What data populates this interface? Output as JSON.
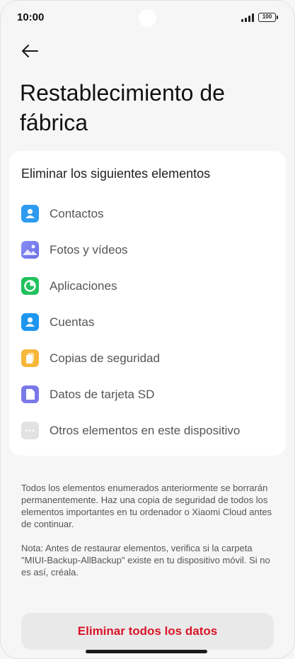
{
  "status_bar": {
    "time": "10:00",
    "battery": "100"
  },
  "header": {
    "back_icon": "arrow-left-icon",
    "title": "Restablecimiento de fábrica"
  },
  "card": {
    "heading": "Eliminar los siguientes elementos",
    "items": [
      {
        "label": "Contactos",
        "icon": "contacts-icon",
        "color": "#2d9bf0"
      },
      {
        "label": "Fotos y vídeos",
        "icon": "gallery-icon",
        "color": "#7c83f2"
      },
      {
        "label": "Aplicaciones",
        "icon": "apps-icon",
        "color": "#21c25e"
      },
      {
        "label": "Cuentas",
        "icon": "accounts-icon",
        "color": "#1e96f0"
      },
      {
        "label": "Copias de seguridad",
        "icon": "backup-icon",
        "color": "#f7b73a"
      },
      {
        "label": "Datos de tarjeta SD",
        "icon": "sd-card-icon",
        "color": "#7b79e8"
      },
      {
        "label": "Otros elementos en este dispositivo",
        "icon": "more-icon",
        "color": "#e2e2e2"
      }
    ]
  },
  "description": "Todos los elementos enumerados anteriormente se borrarán permanentemente. Haz una copia de seguridad de todos los elementos importantes en tu ordenador o Xiaomi Cloud antes de continuar.",
  "note": "Nota: Antes de restaurar elementos, verifica si la carpeta \"MIUI-Backup-AllBackup\" existe en tu dispositivo móvil. Si no es así, créala.",
  "action": {
    "label": "Eliminar todos los datos",
    "color": "#d91528"
  }
}
